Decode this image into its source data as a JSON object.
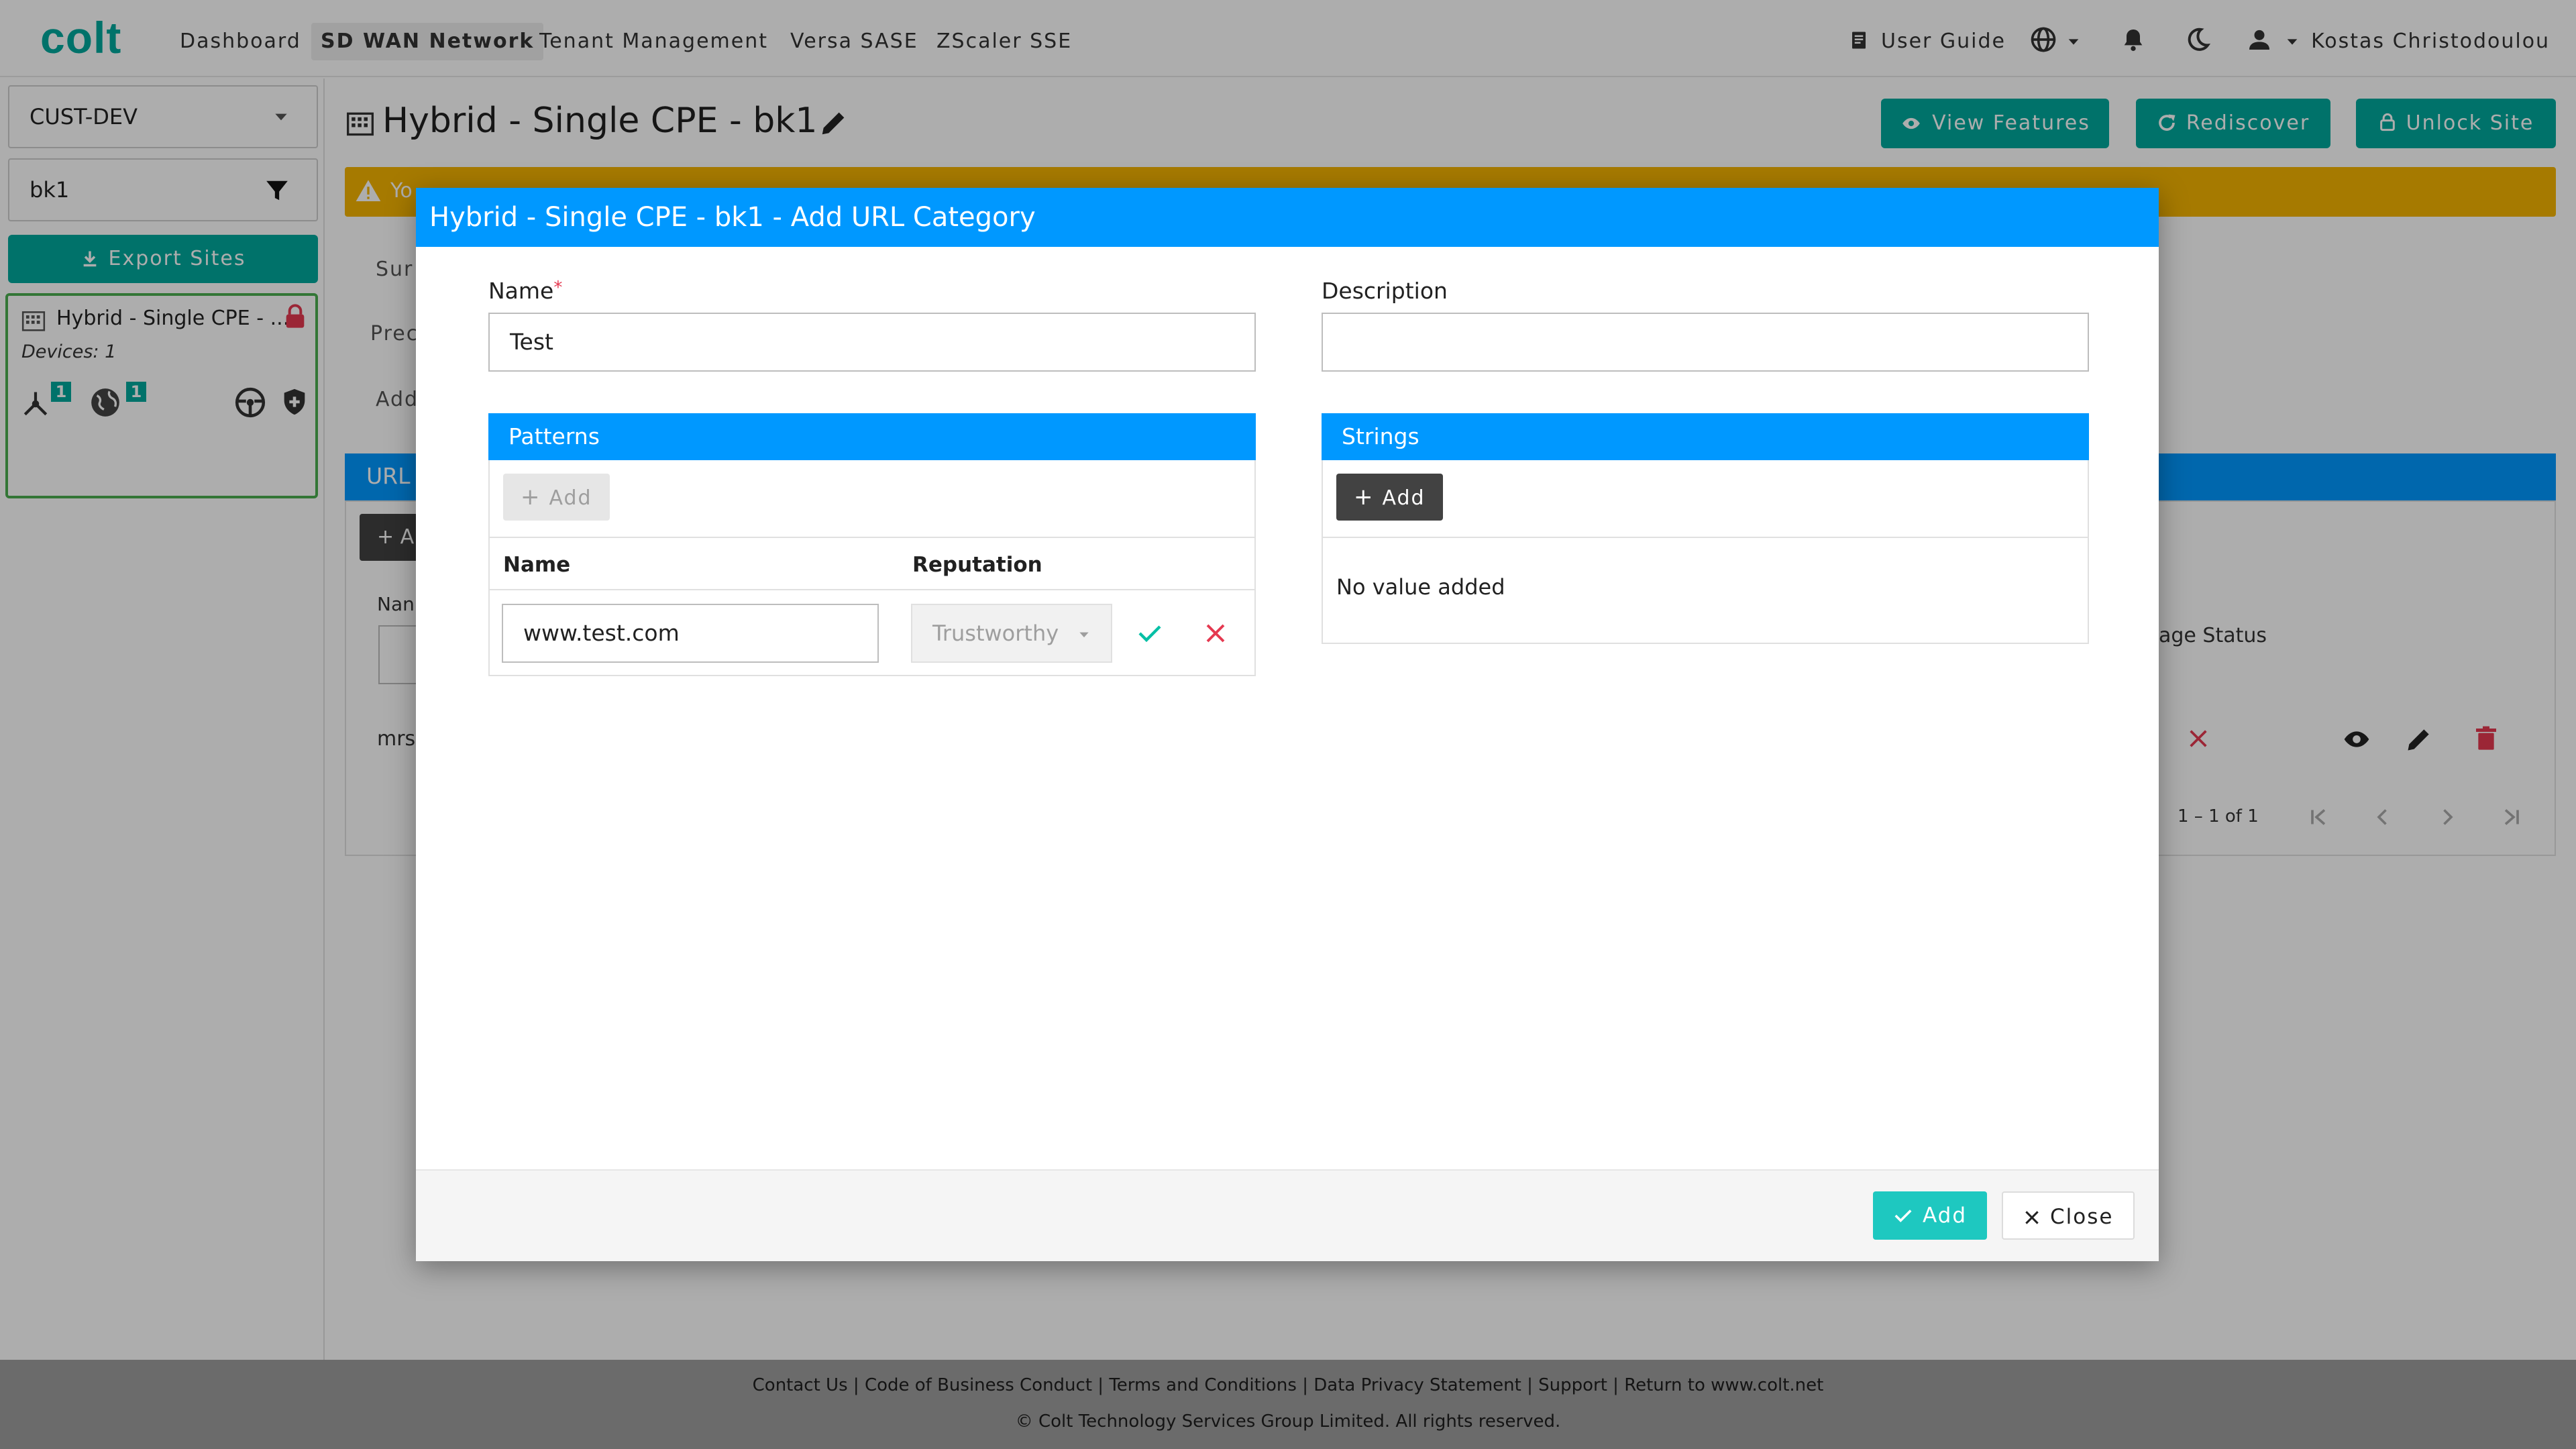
{
  "brand": {
    "logo": "colt",
    "accent": "#00a99d",
    "primary": "#0098ff",
    "warning": "#f5b400",
    "danger": "#e53950"
  },
  "nav": {
    "items": [
      "Dashboard",
      "SD WAN Network",
      "Tenant Management",
      "Versa SASE",
      "ZScaler SSE"
    ],
    "active": "SD WAN Network",
    "user_guide": "User Guide",
    "user_name": "Kostas Christodoulou",
    "icons": [
      "book-icon",
      "globe-icon",
      "bell-icon",
      "moon-icon",
      "user-icon"
    ]
  },
  "sidebar": {
    "customer": "CUST-DEV",
    "filter_value": "bk1",
    "export_label": "Export Sites",
    "site": {
      "name": "Hybrid - Single CPE - ...",
      "devices": "Devices: 1",
      "badge_a": "1",
      "badge_b": "1"
    }
  },
  "page": {
    "title": "Hybrid - Single CPE - bk1",
    "view_features": "View Features",
    "rediscover": "Rediscover",
    "unlock_site": "Unlock Site",
    "warning_fragment": "Yo",
    "tab_fragments": [
      "Sur",
      "Prec",
      "Add"
    ],
    "section_fragment": "URL",
    "add_fragment": "+ A",
    "name_fragment": "Nan",
    "row_fragment": "mrs",
    "status_fragment": "age Status",
    "pagination": "1 – 1 of 1"
  },
  "dialog": {
    "title": "Hybrid - Single CPE - bk1 - Add URL Category",
    "name_label": "Name",
    "required_mark": "*",
    "name_value": "Test",
    "description_label": "Description",
    "description_value": "",
    "patterns": {
      "title": "Patterns",
      "add_label": "Add",
      "col_name": "Name",
      "col_reputation": "Reputation",
      "row_value": "www.test.com",
      "row_reputation": "Trustworthy"
    },
    "strings": {
      "title": "Strings",
      "add_label": "Add",
      "empty_text": "No value added"
    },
    "add_button": "Add",
    "close_button": "Close"
  },
  "footer": {
    "links": [
      "Contact Us",
      "Code of Business Conduct",
      "Terms and Conditions",
      "Data Privacy Statement",
      "Support",
      "Return to www.colt.net"
    ],
    "copyright": "© Colt Technology Services Group Limited. All rights reserved."
  }
}
